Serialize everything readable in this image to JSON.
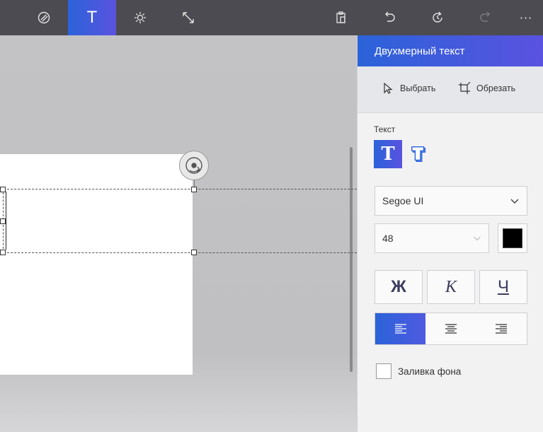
{
  "toolbar": {
    "active_tool_glyph": "T",
    "tools": [
      "partial-left-icon",
      "stickers-icon",
      "text-icon",
      "effects-icon",
      "canvas-icon"
    ],
    "actions": [
      "paste-icon",
      "undo-icon",
      "history-icon",
      "redo-icon",
      "more-icon"
    ],
    "more_label": "···"
  },
  "panel": {
    "title": "Двухмерный текст",
    "select_label": "Выбрать",
    "crop_label": "Обрезать",
    "section_label": "Текст",
    "font_family": "Segoe UI",
    "font_size": "48",
    "bold_label": "Ж",
    "italic_label": "К",
    "underline_label": "Ч",
    "fill_label": "Заливка фона",
    "text_color": "#000000"
  },
  "colors": {
    "accent_start": "#2b63d9",
    "accent_end": "#5a52e0",
    "toolbar_bg": "#4c4b51"
  }
}
